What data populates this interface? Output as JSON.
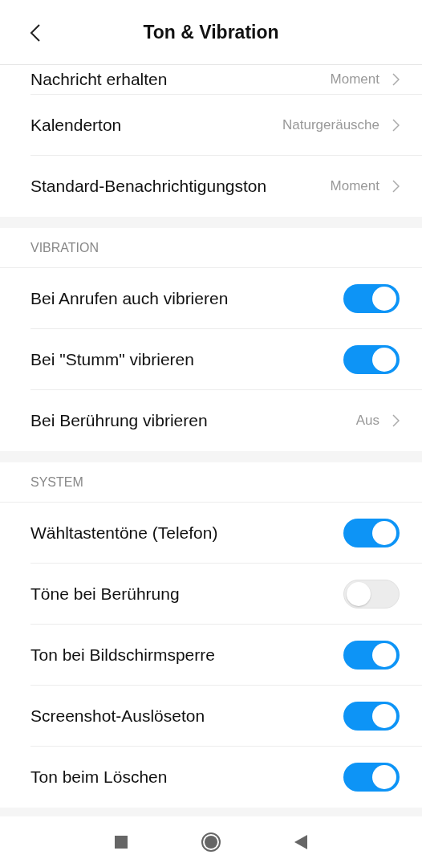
{
  "header": {
    "title": "Ton & Vibration"
  },
  "sections": [
    {
      "items": [
        {
          "kind": "link",
          "label": "Nachricht erhalten",
          "value": "Moment",
          "partial": true
        },
        {
          "kind": "link",
          "label": "Kalenderton",
          "value": "Naturgeräusche"
        },
        {
          "kind": "link",
          "label": "Standard-Benachrichtigungston",
          "value": "Moment"
        }
      ]
    },
    {
      "heading": "VIBRATION",
      "items": [
        {
          "kind": "toggle",
          "label": "Bei Anrufen auch vibrieren",
          "on": true
        },
        {
          "kind": "toggle",
          "label": "Bei \"Stumm\" vibrieren",
          "on": true
        },
        {
          "kind": "link",
          "label": "Bei Berührung vibrieren",
          "value": "Aus"
        }
      ]
    },
    {
      "heading": "SYSTEM",
      "items": [
        {
          "kind": "toggle",
          "label": "Wähltastentöne (Telefon)",
          "on": true
        },
        {
          "kind": "toggle",
          "label": "Töne bei Berührung",
          "on": false
        },
        {
          "kind": "toggle",
          "label": "Ton bei Bildschirmsperre",
          "on": true
        },
        {
          "kind": "toggle",
          "label": "Screenshot-Auslöseton",
          "on": true
        },
        {
          "kind": "toggle",
          "label": "Ton beim Löschen",
          "on": true
        }
      ]
    }
  ]
}
